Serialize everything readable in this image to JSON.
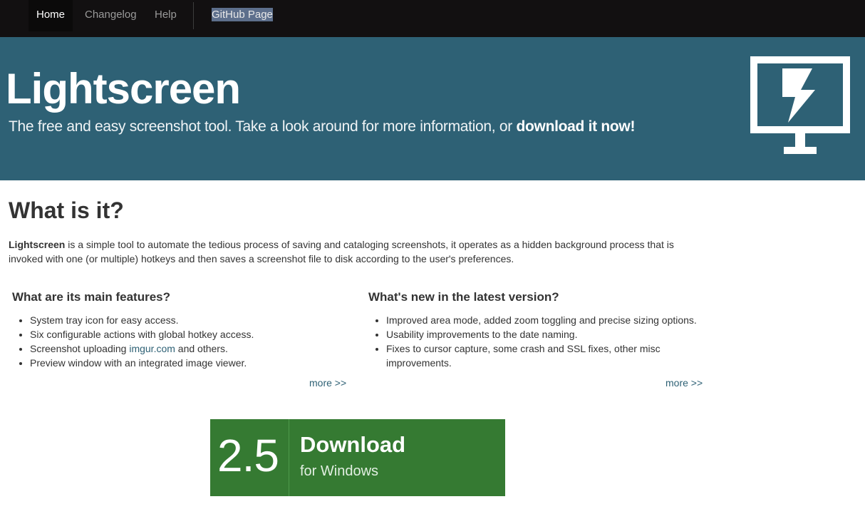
{
  "nav": {
    "home": "Home",
    "changelog": "Changelog",
    "help": "Help",
    "github": "GitHub Page"
  },
  "hero": {
    "title": "Lightscreen",
    "tagline_prefix": "The free and easy screenshot tool. Take a look around for more information, or ",
    "tagline_link": "download it now!",
    "logo_icon": "monitor-lightning-icon"
  },
  "about": {
    "title": "What is it?",
    "intro_bold": "Lightscreen",
    "intro_text": " is a simple tool to automate the tedious process of saving and cataloging screenshots, it operates as a hidden background process that is invoked with one (or multiple) hotkeys and then saves a screenshot file to disk according to the user's preferences."
  },
  "features": {
    "title": "What are its main features?",
    "item1": "System tray icon for easy access.",
    "item2": "Six configurable actions with global hotkey access.",
    "item3_prefix": "Screenshot uploading ",
    "item3_link": "imgur.com",
    "item3_suffix": " and others.",
    "item4": "Preview window with an integrated image viewer.",
    "more": "more >>"
  },
  "whatsnew": {
    "title": "What's new in the latest version?",
    "items": [
      "Improved area mode, added zoom toggling and precise sizing options.",
      "Usability improvements to the date naming.",
      "Fixes to cursor capture, some crash and SSL fixes, other misc improvements."
    ],
    "more": "more >>"
  },
  "download": {
    "version": "2.5",
    "label": "Download",
    "platform": "for Windows"
  },
  "colors": {
    "navbar": "#121011",
    "hero": "#2e6175",
    "download": "#357a32",
    "link": "#2e6175"
  }
}
